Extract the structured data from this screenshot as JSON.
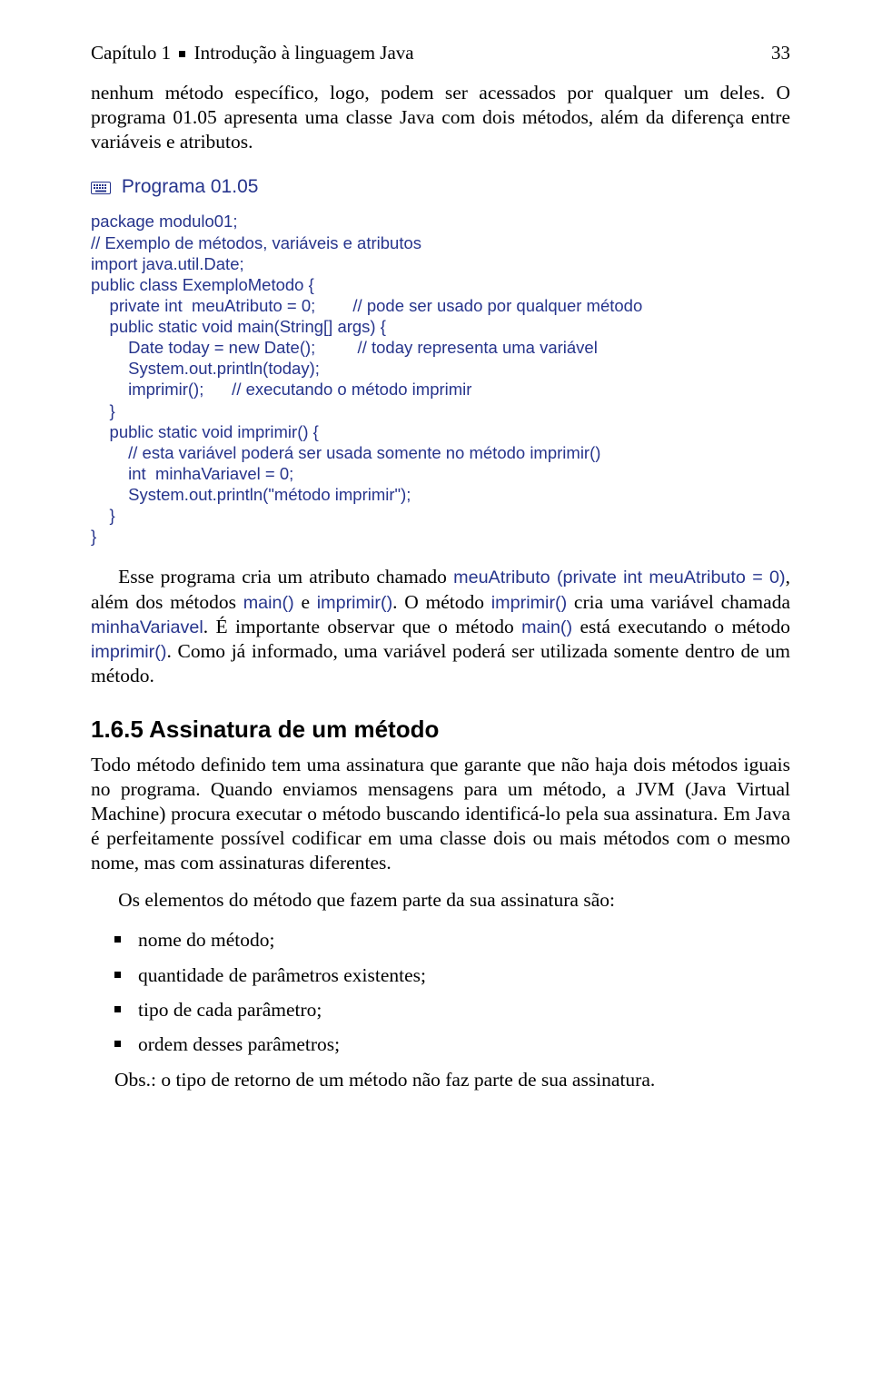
{
  "header": {
    "chapter": "Capítulo 1",
    "title": "Introdução à linguagem Java",
    "page_number": "33"
  },
  "intro_paragraph": "nenhum método específico, logo, podem ser acessados por qualquer um deles. O programa 01.05 apresenta uma classe Java com dois métodos, além da diferença entre variáveis e atributos.",
  "program_label": "Programa 01.05",
  "code": "package modulo01;\n// Exemplo de métodos, variáveis e atributos\nimport java.util.Date;\npublic class ExemploMetodo {\n    private int  meuAtributo = 0;        // pode ser usado por qualquer método\n    public static void main(String[] args) {\n        Date today = new Date();         // today representa uma variável\n        System.out.println(today);\n        imprimir();      // executando o método imprimir\n    }\n    public static void imprimir() {\n        // esta variável poderá ser usada somente no método imprimir()\n        int  minhaVariavel = 0;\n        System.out.println(\"método imprimir\");\n    }\n}",
  "explain": {
    "p1_a": "Esse programa cria um atributo chamado ",
    "p1_code1": "meuAtributo (private int meuAtributo = 0)",
    "p1_b": ", além dos métodos ",
    "p1_code2": "main()",
    "p1_c": " e ",
    "p1_code3": "imprimir()",
    "p1_d": ". O método ",
    "p1_code4": "imprimir()",
    "p1_e": " cria uma variável chamada ",
    "p1_code5": "minhaVariavel",
    "p1_f": ". É importante observar que o método ",
    "p1_code6": "main()",
    "p1_g": " está executando o método ",
    "p1_code7": "imprimir()",
    "p1_h": ". Como já informado, uma variável poderá ser utilizada somente dentro de um método."
  },
  "section_heading": "1.6.5 Assinatura de um método",
  "section_p1": "Todo método definido tem uma assinatura que garante que não haja dois métodos iguais no programa. Quando enviamos mensagens para um método, a JVM (Java Virtual Machine) procura executar o método buscando identificá-lo pela sua assinatura. Em Java é perfeitamente possível codificar em uma classe dois ou mais métodos com o mesmo nome, mas com assinaturas diferentes.",
  "section_p2": "Os elementos do método que fazem parte da sua assinatura são:",
  "bullets": [
    "nome do método;",
    "quantidade de parâmetros existentes;",
    "tipo de cada parâmetro;",
    "ordem desses parâmetros;"
  ],
  "obs": "Obs.: o tipo de retorno de um método não faz parte de sua assinatura."
}
